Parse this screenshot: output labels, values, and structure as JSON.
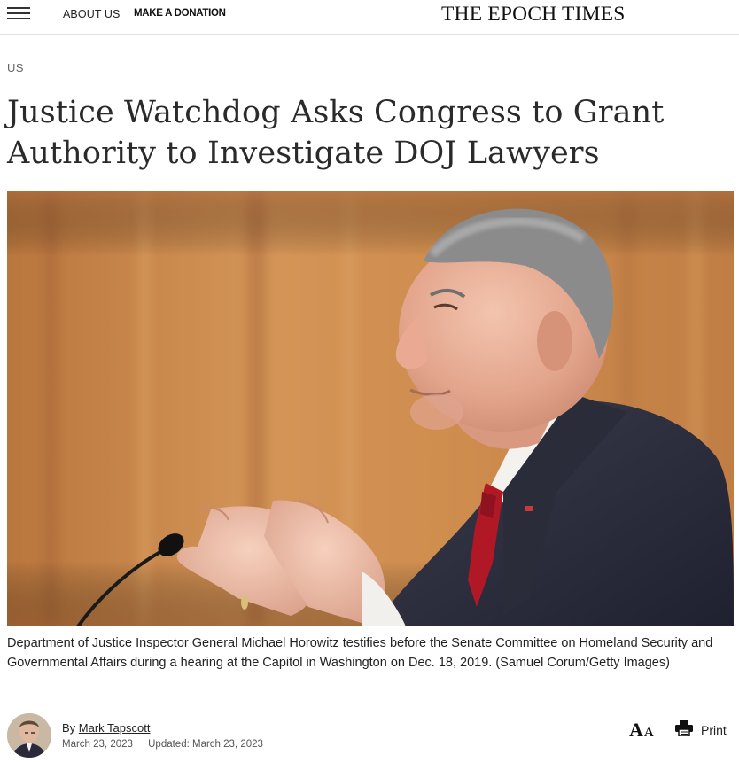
{
  "header": {
    "menu_icon": "hamburger-menu-icon",
    "about_label": "ABOUT US",
    "donate_label": "MAKE A DONATION",
    "masthead": "THE EPOCH TIMES"
  },
  "article": {
    "section": "US",
    "headline": "Justice Watchdog Asks Congress to Grant Authority to Investigate DOJ Lawyers",
    "caption": "Department of Justice Inspector General Michael Horowitz testifies before the Senate Committee on Homeland Security and Governmental Affairs during a hearing at the Capitol in Washington on Dec. 18, 2019. (Samuel Corum/Getty Images)"
  },
  "byline": {
    "prefix": "By",
    "author": "Mark Tapscott",
    "published": "March 23, 2023",
    "updated": "Updated: March 23, 2023"
  },
  "tools": {
    "font_big": "A",
    "font_small": "A",
    "font_icon": "font-size-icon",
    "print_icon": "printer-icon",
    "print_label": "Print"
  },
  "colors": {
    "hero_wood": "#c8894f",
    "tie": "#b01825",
    "suit": "#2c2e3d"
  }
}
